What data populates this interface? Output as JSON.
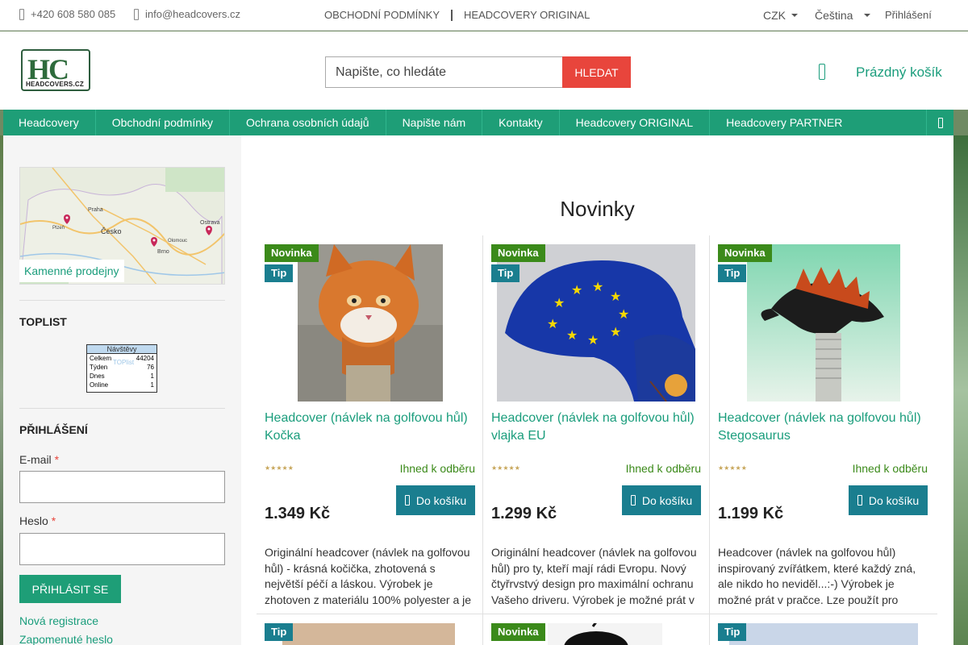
{
  "topbar": {
    "phone": "+420 608 580 085",
    "email": "info@headcovers.cz",
    "links": [
      "OBCHODNÍ PODMÍNKY",
      "HEADCOVERY ORIGINAL"
    ],
    "currency": "CZK",
    "language": "Čeština",
    "login": "Přihlášení"
  },
  "header": {
    "logo_text": "HC",
    "logo_sub": "HEADCOVERS.CZ",
    "search_placeholder": "Napište, co hledáte",
    "search_button": "HLEDAT",
    "cart": "Prázdný košík"
  },
  "nav": [
    "Headcovery",
    "Obchodní podmínky",
    "Ochrana osobních údajů",
    "Napište nám",
    "Kontakty",
    "Headcovery ORIGINAL",
    "Headcovery PARTNER"
  ],
  "sidebar": {
    "map_label": "Kamenné prodejny",
    "map_towns": [
      "Praha",
      "Česko",
      "Brno",
      "Ostrava",
      "Olomouc",
      "Plzeň"
    ],
    "toplist_title": "TOPLIST",
    "toplist": {
      "header": "Návštěvy",
      "rows": [
        {
          "label": "Celkem",
          "value": "44204"
        },
        {
          "label": "Týden",
          "value": "76"
        },
        {
          "label": "Dnes",
          "value": "1"
        },
        {
          "label": "Online",
          "value": "1"
        }
      ],
      "watermark": "TOPlist"
    },
    "login_title": "PŘIHLÁŠENÍ",
    "email_label": "E-mail",
    "password_label": "Heslo",
    "required_mark": "*",
    "login_button": "PŘIHLÁSIT SE",
    "register_link": "Nová registrace",
    "forgot_link": "Zapomenuté heslo"
  },
  "main": {
    "title": "Novinky",
    "badge_new": "Novinka",
    "badge_tip": "Tip",
    "stars": "★★★★★",
    "products": [
      {
        "name": "Headcover (návlek na golfovou hůl) Kočka",
        "availability": "Ihned k odběru",
        "price": "1.349 Kč",
        "button": "Do košíku",
        "description": "Originální headcover (návlek na golfovou hůl) - krásná kočička, zhotovená s největší péčí a láskou. Výrobek je zhotoven z materiálu 100% polyester a je"
      },
      {
        "name": "Headcover (návlek na golfovou hůl) vlajka EU",
        "availability": "Ihned k odběru",
        "price": "1.299 Kč",
        "button": "Do košíku",
        "description": "Originální headcover (návlek na golfovou hůl) pro ty, kteří mají rádi Evropu. Nový čtyřrvstvý design pro maximální ochranu Vašeho driveru. Výrobek je možné prát v"
      },
      {
        "name": "Headcover (návlek na golfovou hůl) Stegosaurus",
        "availability": "Ihned k odběru",
        "price": "1.199 Kč",
        "button": "Do košíku",
        "description": "Headcover (návlek na golfovou hůl) inspirovaný zvířátkem, které každý zná, ale nikdo ho neviděl...:-) Výrobek je možné prát v pračce. Lze použít pro"
      }
    ],
    "row2_badges": [
      "Tip",
      "Novinka",
      "Tip"
    ]
  },
  "colors": {
    "accent": "#1e9e77",
    "link": "#1a9d7c",
    "search_button": "#e8453c",
    "badge_new": "#3b8a1a",
    "badge_tip": "#1a7e8f"
  }
}
